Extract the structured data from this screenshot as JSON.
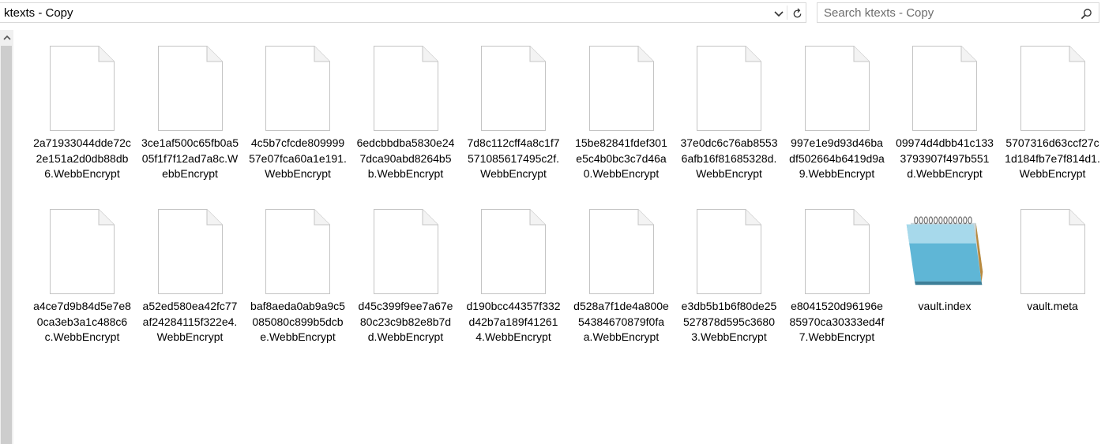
{
  "address_bar": {
    "path": "ktexts - Copy",
    "dropdown_icon": "chevron-down-icon",
    "refresh_icon": "refresh-icon"
  },
  "search": {
    "placeholder": "Search ktexts - Copy",
    "icon": "search-icon"
  },
  "scrollbar": {
    "up_icon": "chevron-up-icon"
  },
  "files": [
    {
      "name": "2a71933044dde72c2e151a2d0db88db6.WebbEncrypt",
      "icon": "blank-file-icon"
    },
    {
      "name": "3ce1af500c65fb0a505f1f7f12ad7a8c.WebbEncrypt",
      "icon": "blank-file-icon"
    },
    {
      "name": "4c5b7cfcde80999957e07fca60a1e191.WebbEncrypt",
      "icon": "blank-file-icon"
    },
    {
      "name": "6edcbbdba5830e247dca90abd8264b5b.WebbEncrypt",
      "icon": "blank-file-icon"
    },
    {
      "name": "7d8c112cff4a8c1f7571085617495c2f.WebbEncrypt",
      "icon": "blank-file-icon"
    },
    {
      "name": "15be82841fdef301e5c4b0bc3c7d46a0.WebbEncrypt",
      "icon": "blank-file-icon"
    },
    {
      "name": "37e0dc6c76ab85536afb16f81685328d.WebbEncrypt",
      "icon": "blank-file-icon"
    },
    {
      "name": "997e1e9d93d46badf502664b6419d9a9.WebbEncrypt",
      "icon": "blank-file-icon"
    },
    {
      "name": "09974d4dbb41c1333793907f497b551d.WebbEncrypt",
      "icon": "blank-file-icon"
    },
    {
      "name": "5707316d63ccf27c1d184fb7e7f814d1.WebbEncrypt",
      "icon": "blank-file-icon"
    },
    {
      "name": "a4ce7d9b84d5e7e80ca3eb3a1c488c6c.WebbEncrypt",
      "icon": "blank-file-icon"
    },
    {
      "name": "a52ed580ea42fc77af24284115f322e4.WebbEncrypt",
      "icon": "blank-file-icon"
    },
    {
      "name": "baf8aeda0ab9a9c5085080c899b5dcbe.WebbEncrypt",
      "icon": "blank-file-icon"
    },
    {
      "name": "d45c399f9ee7a67e80c23c9b82e8b7dd.WebbEncrypt",
      "icon": "blank-file-icon"
    },
    {
      "name": "d190bcc44357f332d42b7a189f412614.WebbEncrypt",
      "icon": "blank-file-icon"
    },
    {
      "name": "d528a7f1de4a800e54384670879f0fa a.WebbEncrypt",
      "icon": "blank-file-icon"
    },
    {
      "name": "e3db5b1b6f80de25527878d595c36803.WebbEncrypt",
      "icon": "blank-file-icon"
    },
    {
      "name": "e8041520d96196e85970ca30333ed4f7.WebbEncrypt",
      "icon": "blank-file-icon"
    },
    {
      "name": "vault.index",
      "icon": "notepad-icon"
    },
    {
      "name": "vault.meta",
      "icon": "blank-file-icon"
    }
  ]
}
